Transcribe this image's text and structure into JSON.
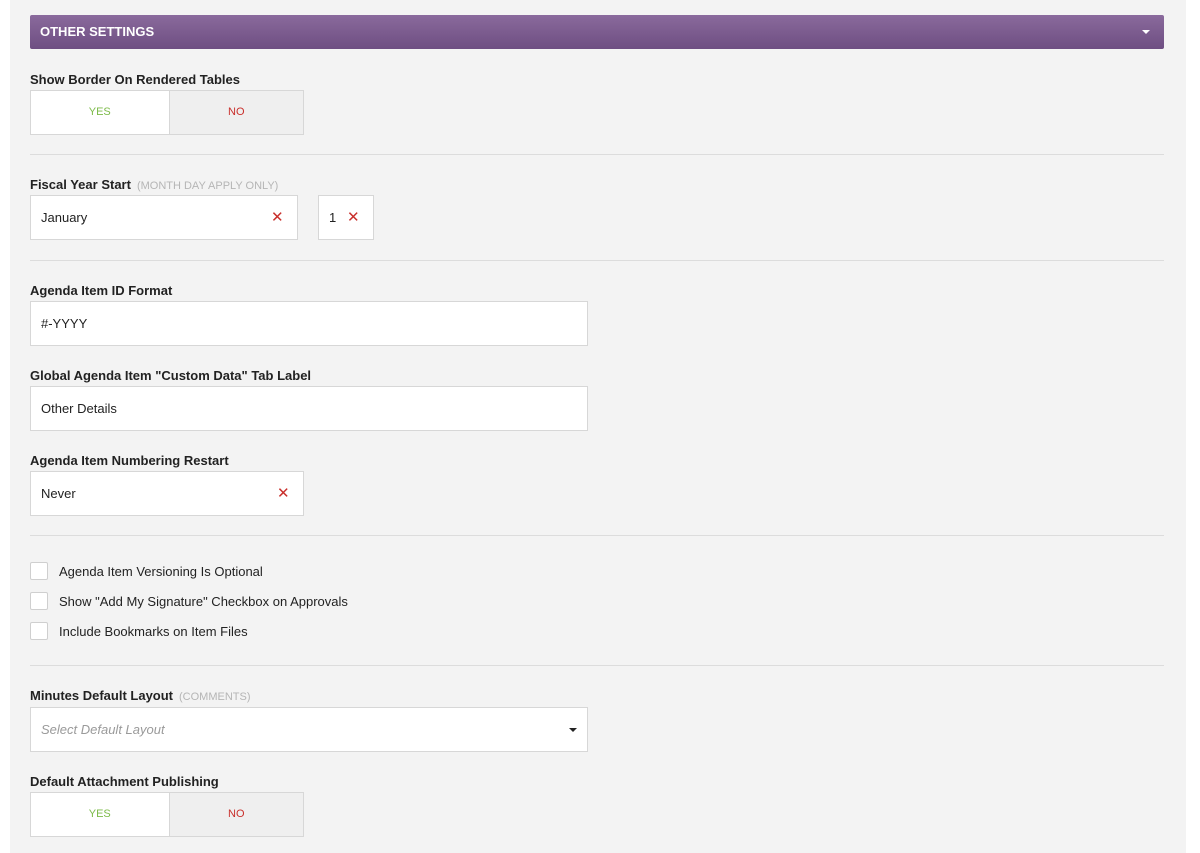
{
  "section": {
    "title": "OTHER SETTINGS",
    "toggle_icon": "caret-down-icon"
  },
  "show_border": {
    "label": "Show Border On Rendered Tables",
    "yes": "YES",
    "no": "NO",
    "selected": "YES"
  },
  "fiscal_year": {
    "label": "Fiscal Year Start",
    "hint": "(MONTH DAY APPLY ONLY)",
    "month": "January",
    "day": "1",
    "clear_glyph": "✕"
  },
  "id_format": {
    "label": "Agenda Item ID Format",
    "value": "#-YYYY"
  },
  "custom_tab": {
    "label": "Global Agenda Item \"Custom Data\" Tab Label",
    "value": "Other Details"
  },
  "numbering_restart": {
    "label": "Agenda Item Numbering Restart",
    "value": "Never",
    "clear_glyph": "✕"
  },
  "checkboxes": [
    {
      "label": "Agenda Item Versioning Is Optional",
      "checked": false
    },
    {
      "label": "Show \"Add My Signature\" Checkbox on Approvals",
      "checked": false
    },
    {
      "label": "Include Bookmarks on Item Files",
      "checked": false
    }
  ],
  "minutes_layout": {
    "label": "Minutes Default Layout",
    "hint": "(COMMENTS)",
    "placeholder": "Select Default Layout"
  },
  "attachment_publishing": {
    "label": "Default Attachment Publishing",
    "yes": "YES",
    "no": "NO",
    "selected": "YES"
  },
  "colors": {
    "header": "#7a5a8e",
    "yes": "#7dbb4a",
    "no": "#c9302c"
  }
}
